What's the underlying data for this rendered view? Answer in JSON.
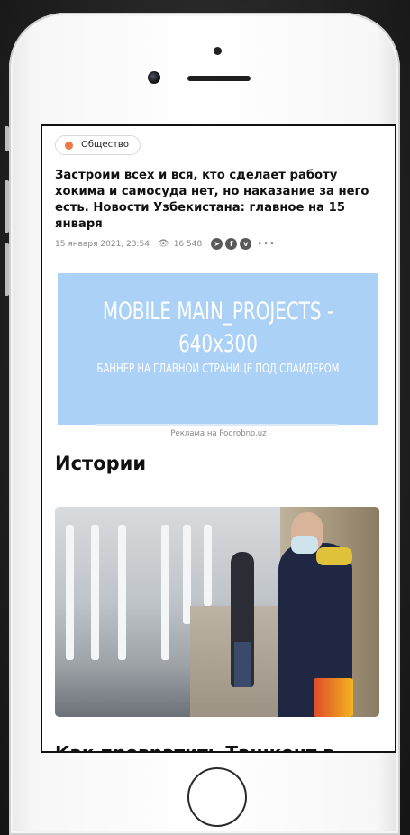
{
  "article": {
    "category": "Общество",
    "headline": "Застроим всех и вся, кто сделает работу хокима и самосуда нет, но наказание за него есть. Новости Узбекистана: главное на 15 января",
    "date": "15 января 2021, 23:54",
    "views": "16 548"
  },
  "share_icons": [
    "telegram-icon",
    "facebook-icon",
    "vk-icon",
    "more-icon"
  ],
  "banner": {
    "title_line1": "MOBILE MAIN_PROJECTS  -",
    "title_line2": "640x300",
    "subtitle": "БАННЕР НА ГЛАВНОЙ СТРАНИЦЕ ПОД СЛАЙДЕРОМ",
    "caption": "Реклама на Podrobno.uz"
  },
  "stories": {
    "section_title": "Истории",
    "next_title": "Как превратить Ташкент в"
  },
  "colors": {
    "category_dot": "#ef7a45",
    "banner_bg": "#acd1f7"
  }
}
